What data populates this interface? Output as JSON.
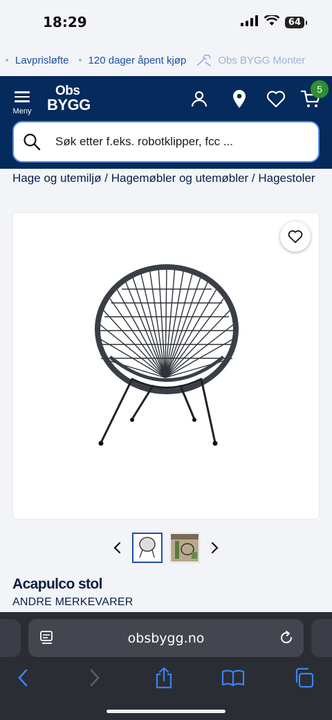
{
  "status_bar": {
    "time": "18:29",
    "battery": "64"
  },
  "usp_bar": {
    "items": [
      {
        "label": "Lavprisløfte",
        "icon": "dot-icon"
      },
      {
        "label": "120 dager åpent kjøp",
        "icon": "dot-icon"
      },
      {
        "label": "Obs BYGG Monter",
        "icon": "tools-icon"
      }
    ]
  },
  "header": {
    "menu_label": "Meny",
    "logo_line1": "Obs",
    "logo_line2": "BYGG",
    "icons": [
      "user-icon",
      "location-pin-icon",
      "heart-icon",
      "cart-icon"
    ],
    "cart_count": "5"
  },
  "search": {
    "placeholder": "Søk etter f.eks. robotklipper, fcc ..."
  },
  "breadcrumb": {
    "items": [
      "Hage og utemiljø",
      "Hagemøbler og utemøbler",
      "Hagestoler"
    ],
    "separator": "/"
  },
  "product": {
    "title": "Acapulco stol",
    "brand": "ANDRE MERKEVARER",
    "image": "acapulco-chair-photo",
    "thumbnails": [
      "chair-thumbnail",
      "garden-scene-thumbnail"
    ]
  },
  "browser": {
    "url": "obsbygg.no"
  },
  "colors": {
    "header_bg": "#052a5c",
    "accent_blue": "#1d4ea3",
    "badge_green": "#2f8f2f",
    "search_border": "#4f8fe6"
  }
}
